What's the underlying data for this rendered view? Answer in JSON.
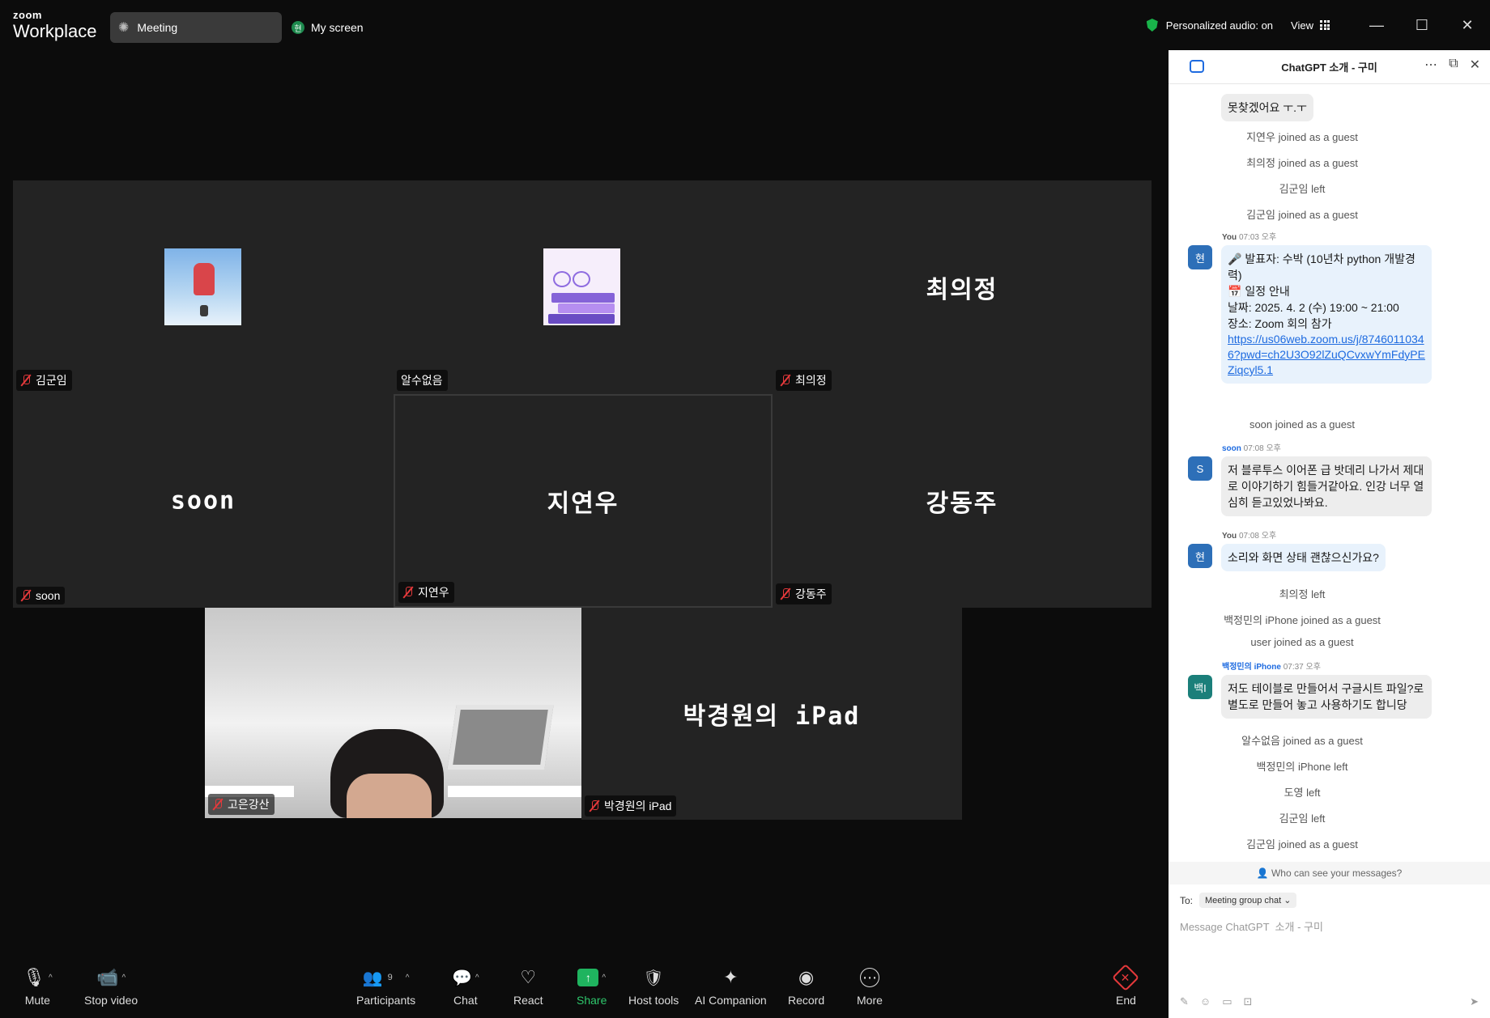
{
  "brand": {
    "small": "zoom",
    "big": "Workplace"
  },
  "tabs": {
    "meeting": "Meeting",
    "screen": "My screen",
    "screen_avatar": "현"
  },
  "top_right": {
    "audio": "Personalized audio: on",
    "view": "View"
  },
  "window_controls": {
    "minimize": "—",
    "maximize": "☐",
    "close": "✕"
  },
  "tiles": [
    {
      "name": "김군임",
      "muted": true,
      "display": "image-sky"
    },
    {
      "name": "알수없음",
      "muted": false,
      "display": "image-books"
    },
    {
      "name": "최의정",
      "muted": true,
      "display_text": "최의정"
    },
    {
      "name": "soon",
      "muted": true,
      "display_text": "soon"
    },
    {
      "name": "지연우",
      "muted": true,
      "display_text": "지연우",
      "active": true
    },
    {
      "name": "강동주",
      "muted": true,
      "display_text": "강동주"
    },
    {
      "name": "고은강산",
      "muted": true,
      "display": "camera"
    },
    {
      "name": "박경원의 iPad",
      "muted": true,
      "display_text": "박경원의 iPad"
    }
  ],
  "toolbar": {
    "mute": "Mute",
    "stop_video": "Stop video",
    "participants": "Participants",
    "participants_count": "9",
    "chat": "Chat",
    "react": "React",
    "share": "Share",
    "host_tools": "Host tools",
    "ai_companion": "AI Companion",
    "record": "Record",
    "more": "More",
    "end": "End"
  },
  "chat": {
    "title": "ChatGPT 소개 - 구미",
    "messages": {
      "m1_text": "못찾겠어요 ㅜ.ㅜ",
      "s1": "지연우 joined as a guest",
      "s2": "최의정 joined as a guest",
      "s3": "김군임 left",
      "s4": "김군임 joined as a guest",
      "m2_sender": "You",
      "m2_time": "07:03 오후",
      "m2_avatar": "현",
      "m2_line1": "🎤 발표자: 수박 (10년차 python 개발경력)",
      "m2_line2": "📅 일정 안내",
      "m2_line3": "날짜: 2025. 4. 2 (수) 19:00 ~ 21:00",
      "m2_line4": "장소:  Zoom 회의 참가",
      "m2_link": "https://us06web.zoom.us/j/87460110346?pwd=ch2U3O92lZuQCvxwYmFdyPEZiqcyl5.1",
      "s5": "soon joined as a guest",
      "m3_sender": "soon",
      "m3_time": "07:08 오후",
      "m3_avatar": "S",
      "m3_text": "저 블루투스 이어폰 급 밧데리 나가서 제대로 이야기하기 힘들거같아요. 인강 너무 열심히 듣고있었나봐요.",
      "m4_sender": "You",
      "m4_time": "07:08 오후",
      "m4_avatar": "현",
      "m4_text": "소리와 화면 상태 괜찮으신가요?",
      "s6": "최의정 left",
      "s7": "백정민의 iPhone joined as a guest",
      "s8": "user joined as a guest",
      "m5_sender": "백정민의 iPhone",
      "m5_time": "07:37 오후",
      "m5_avatar": "백I",
      "m5_text": "저도 테이블로 만들어서 구글시트 파일?로 별도로 만들어 놓고 사용하기도 합니당",
      "s9": "알수없음 joined as a guest",
      "s10": "백정민의 iPhone left",
      "s11": "도영 left",
      "s12": "김군임 left",
      "s13": "김군임 joined as a guest"
    },
    "privacy": "Who can see your messages?",
    "to_label": "To:",
    "to_value": "Meeting group chat ⌄",
    "input_placeholder": "Message ChatGPT  소개 - 구미"
  },
  "colors": {
    "accent": "#1e6be0",
    "mute_red": "#e5393b",
    "share_green": "#1fb45f"
  }
}
